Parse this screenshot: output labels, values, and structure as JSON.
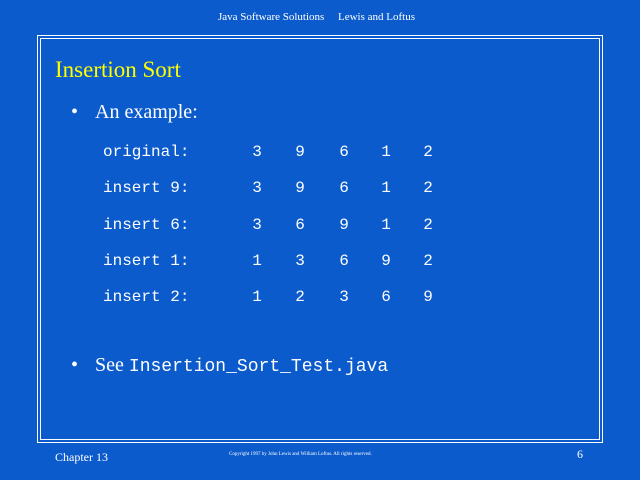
{
  "header": {
    "book": "Java Software Solutions",
    "authors": "Lewis and Loftus"
  },
  "slide": {
    "title": "Insertion Sort",
    "bullets": [
      {
        "text": "An example:"
      },
      {
        "prefix": "See ",
        "code": "Insertion_Sort_Test.java"
      }
    ],
    "bullet_symbol": "•"
  },
  "example": {
    "rows": [
      {
        "label": "original:",
        "values": [
          "3",
          "9",
          "6",
          "1",
          "2"
        ]
      },
      {
        "label": "insert 9:",
        "values": [
          "3",
          "9",
          "6",
          "1",
          "2"
        ]
      },
      {
        "label": "insert 6:",
        "values": [
          "3",
          "6",
          "9",
          "1",
          "2"
        ]
      },
      {
        "label": "insert 1:",
        "values": [
          "1",
          "3",
          "6",
          "9",
          "2"
        ]
      },
      {
        "label": "insert 2:",
        "values": [
          "1",
          "2",
          "3",
          "6",
          "9"
        ]
      }
    ]
  },
  "footer": {
    "chapter": "Chapter 13",
    "copyright": "Copyright 1997 by John Lewis and William Loftus.  All rights reserved.",
    "page": "6"
  },
  "colors": {
    "background": "#0b5bcc",
    "title": "#ffff00",
    "text": "#ffffff"
  }
}
